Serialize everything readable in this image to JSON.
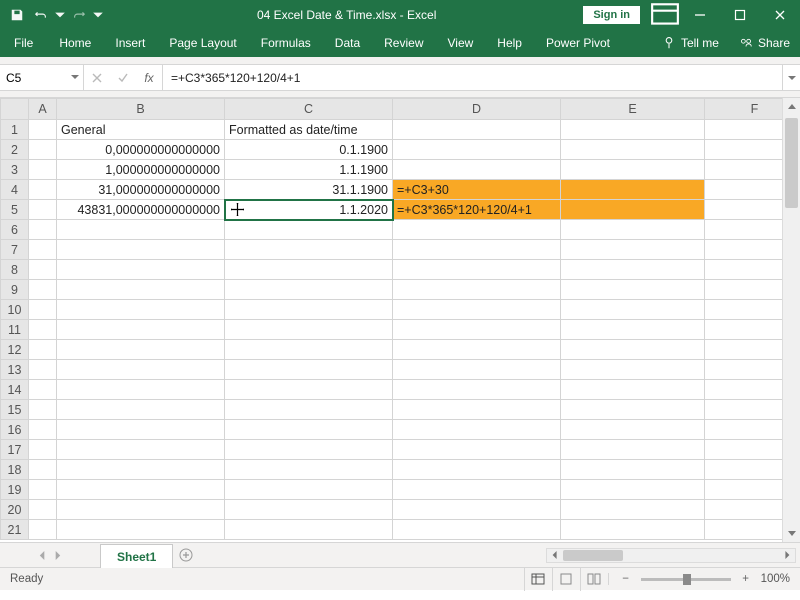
{
  "titlebar": {
    "doc_title": "04 Excel Date & Time.xlsx  -  Excel",
    "signin": "Sign in"
  },
  "ribbon": {
    "tabs": [
      "File",
      "Home",
      "Insert",
      "Page Layout",
      "Formulas",
      "Data",
      "Review",
      "View",
      "Help",
      "Power Pivot"
    ],
    "tellme": "Tell me",
    "share": "Share"
  },
  "formula": {
    "namebox": "C5",
    "fx_label": "fx",
    "content": "=+C3*365*120+120/4+1"
  },
  "grid": {
    "col_headers": [
      "A",
      "B",
      "C",
      "D",
      "E",
      "F"
    ],
    "row_headers": [
      "1",
      "2",
      "3",
      "4",
      "5",
      "6",
      "7",
      "8",
      "9",
      "10",
      "11",
      "12",
      "13",
      "14",
      "15",
      "16",
      "17",
      "18",
      "19",
      "20",
      "21"
    ],
    "cells": {
      "B1": "General",
      "C1": "Formatted as date/time",
      "B2": "0,000000000000000",
      "C2": "0.1.1900",
      "B3": "1,000000000000000",
      "C3": "1.1.1900",
      "B4": "31,000000000000000",
      "C4": "31.1.1900",
      "D4": "=+C3+30",
      "B5": "43831,000000000000000",
      "C5": "1.1.2020",
      "D5": "=+C3*365*120+120/4+1"
    }
  },
  "sheettabs": {
    "active": "Sheet1"
  },
  "statusbar": {
    "mode": "Ready",
    "zoom": "100%"
  }
}
